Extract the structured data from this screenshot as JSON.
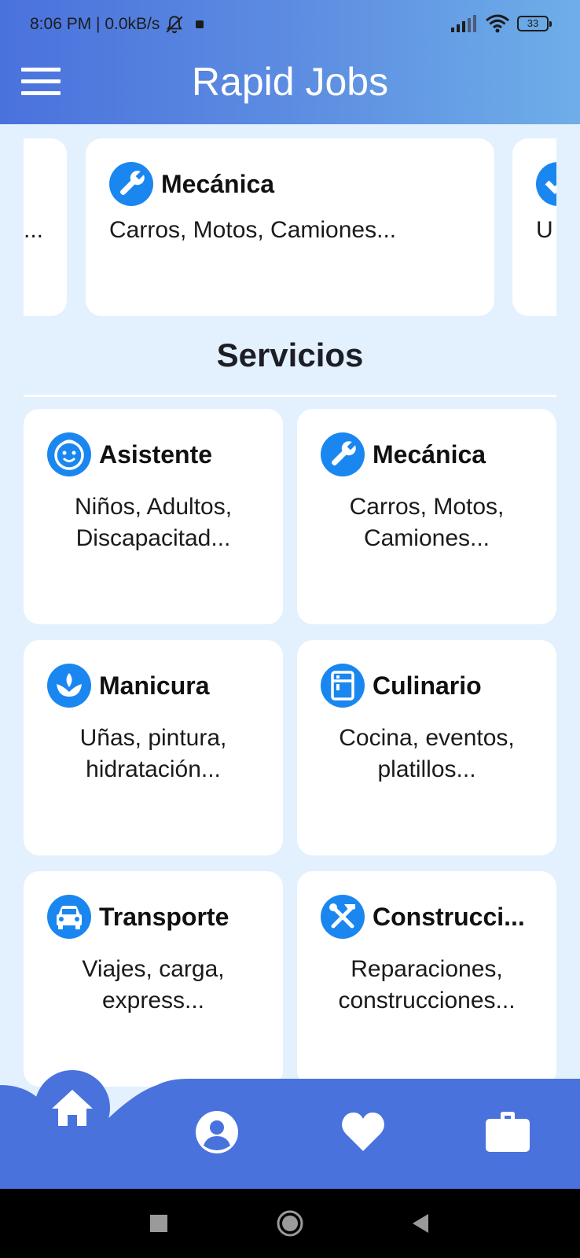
{
  "status_bar": {
    "time_and_speed": "8:06 PM | 0.0kB/s",
    "battery": "33",
    "icons": [
      "bell-off-icon",
      "notification-dot-icon",
      "signal-icon",
      "wifi-icon",
      "battery-icon"
    ]
  },
  "header": {
    "title": "Rapid Jobs",
    "menu_icon": "menu-icon"
  },
  "carousel": {
    "items": [
      {
        "title": "",
        "description": "..."
      },
      {
        "title": "Mecánica",
        "description": "Carros, Motos, Camiones...",
        "icon": "wrench-icon"
      },
      {
        "title": "",
        "description": "U",
        "icon": "partial-icon"
      }
    ]
  },
  "services": {
    "title": "Servicios",
    "items": [
      {
        "title": "Asistente",
        "description": "Niños, Adultos, Discapacitad...",
        "icon": "smiley-icon"
      },
      {
        "title": "Mecánica",
        "description": "Carros, Motos, Camiones...",
        "icon": "wrench-icon"
      },
      {
        "title": "Manicura",
        "description": "Uñas, pintura, hidratación...",
        "icon": "spa-icon"
      },
      {
        "title": "Culinario",
        "description": "Cocina, eventos, platillos...",
        "icon": "kitchen-icon"
      },
      {
        "title": "Transporte",
        "description": "Viajes, carga, express...",
        "icon": "car-icon"
      },
      {
        "title": "Construcci...",
        "description": "Reparaciones, construcciones...",
        "icon": "tools-icon"
      }
    ]
  },
  "bottom_nav": {
    "items": [
      "home-icon",
      "profile-icon",
      "heart-icon",
      "briefcase-icon"
    ],
    "active": "home"
  },
  "colors": {
    "primary": "#4a72dc",
    "header_end": "#6eaee8",
    "background": "#e3f0fd",
    "icon_blue": "#1a87f0",
    "card": "#ffffff"
  }
}
